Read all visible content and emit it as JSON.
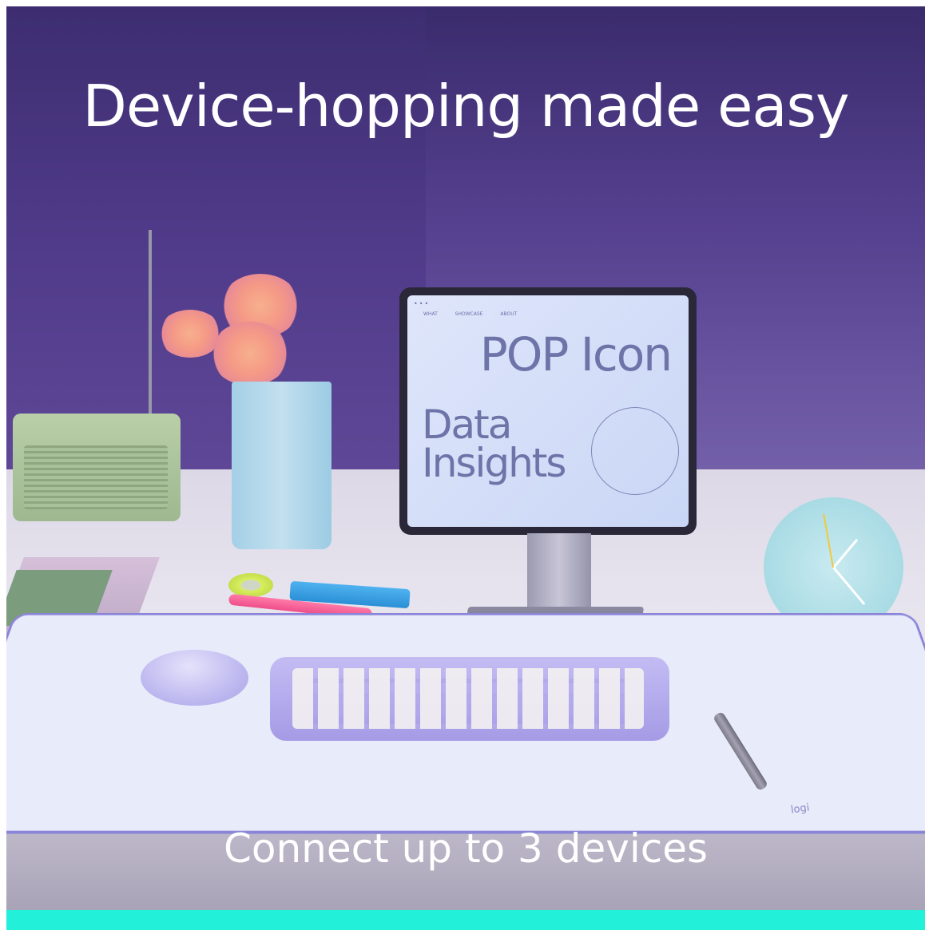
{
  "headline": "Device-hopping made easy",
  "subline": "Connect up to 3 devices",
  "screen": {
    "dots": "•••",
    "nav": "WHAT  SHOWCASE  ABOUT",
    "title": "POP Icon",
    "body_line1": "Data",
    "body_line2": "Insights"
  },
  "mat_logo": "logi",
  "colors": {
    "accent_bar": "#22f0d8",
    "wall": "#4b3585",
    "keyboard": "#a59be6"
  }
}
